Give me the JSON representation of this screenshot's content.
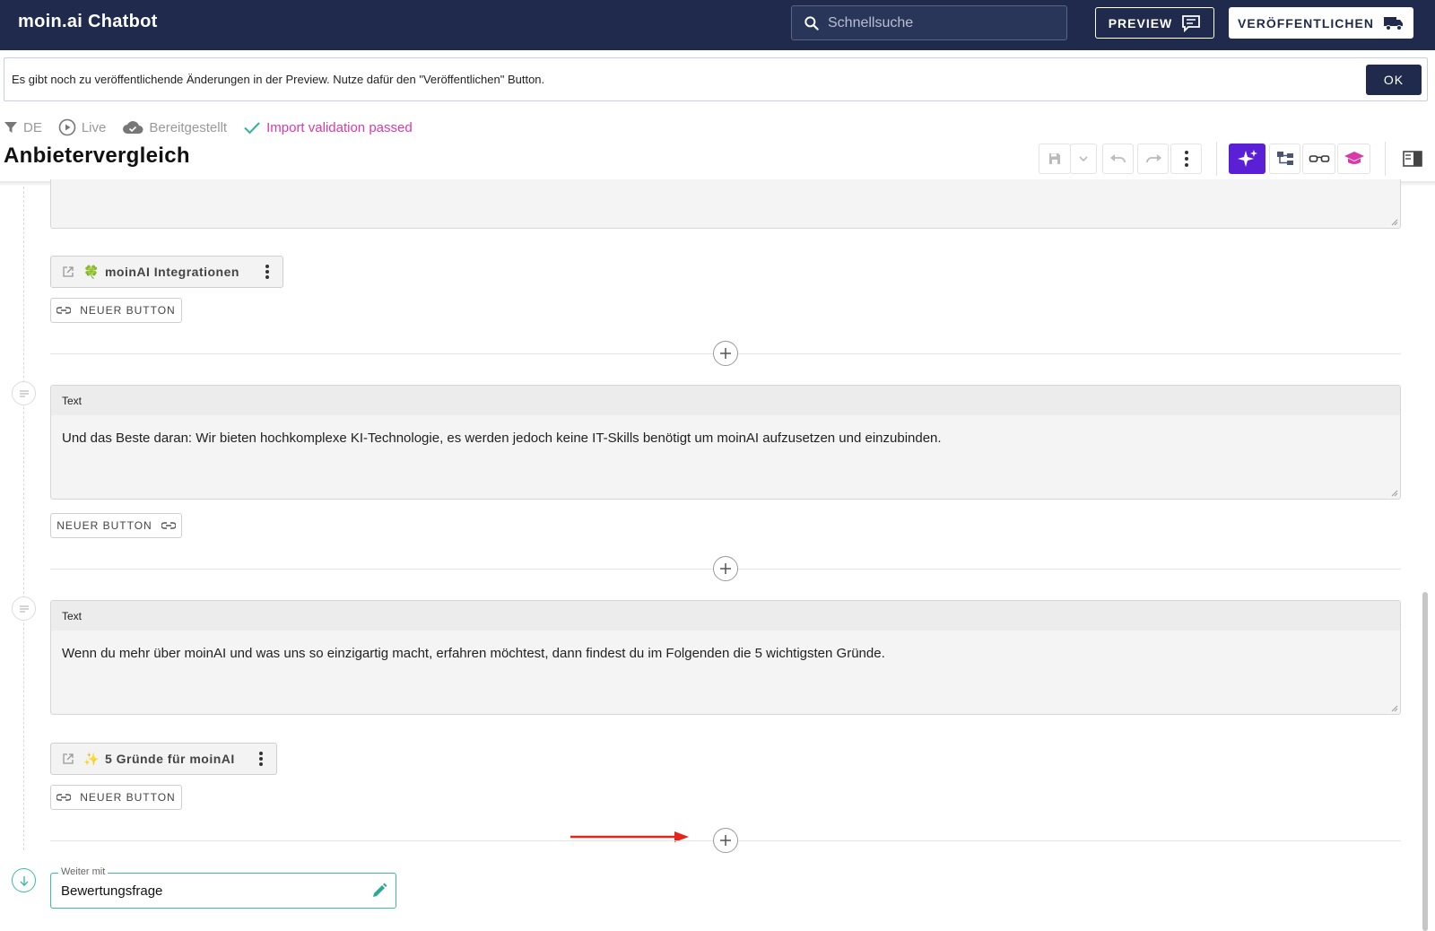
{
  "appbar": {
    "title": "moin.ai Chatbot",
    "search_placeholder": "Schnellsuche",
    "preview_label": "PREVIEW",
    "publish_label": "VERÖFFENTLICHEN"
  },
  "notice": {
    "message": "Es gibt noch zu veröffentlichende Änderungen in der Preview. Nutze dafür den \"Veröffentlichen\" Button.",
    "ok_label": "OK"
  },
  "status": {
    "language": "DE",
    "live": "Live",
    "deployed": "Bereitgestellt",
    "validation": "Import validation passed"
  },
  "page_title": "Anbietervergleich",
  "toolbar_icons": [
    "save-icon",
    "chevron-down-icon",
    "undo-icon",
    "redo-icon",
    "more-vert-icon",
    "sparkle-icon",
    "tree-icon",
    "glasses-icon",
    "graduation-cap-icon",
    "panel-icon"
  ],
  "blocks": {
    "button_chip_1": {
      "emoji": "🍀",
      "label": "moinAI Integrationen"
    },
    "new_button_1": "NEUER BUTTON",
    "text_block_1": {
      "header": "Text",
      "body": "Und das Beste daran: Wir bieten hochkomplexe KI-Technologie, es werden jedoch keine IT-Skills benötigt um moinAI aufzusetzen und einzubinden."
    },
    "new_button_2": "NEUER BUTTON",
    "text_block_2": {
      "header": "Text",
      "body": "Wenn du mehr über moinAI und was uns so einzigartig macht, erfahren möchtest, dann findest du im Folgenden die 5 wichtigsten Gründe."
    },
    "button_chip_2": {
      "emoji": "✨",
      "label": "5 Gründe für moinAI"
    },
    "new_button_3": "NEUER BUTTON"
  },
  "continue_with": {
    "label": "Weiter mit",
    "value": "Bewertungsfrage"
  },
  "colors": {
    "appbar": "#1f2a4d",
    "accent_purple": "#5b1fd6",
    "validation_pink": "#d93aa8",
    "teal": "#3fb8a6",
    "arrow_red": "#e8231a"
  }
}
